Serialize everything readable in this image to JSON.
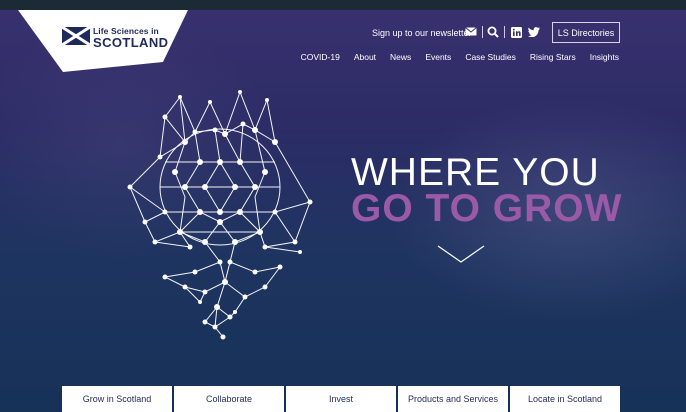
{
  "logo": {
    "top": "Life Sciences in",
    "main": "SCOTLAND"
  },
  "utility": {
    "newsletter": "Sign up to our newsletter",
    "directories": "LS Directories"
  },
  "icons": [
    "envelope-icon",
    "search-icon",
    "linkedin-icon",
    "twitter-icon",
    "chevron-down-icon"
  ],
  "nav": [
    "COVID-19",
    "About",
    "News",
    "Events",
    "Case Studies",
    "Rising Stars",
    "Insights"
  ],
  "hero": {
    "line1": "WHERE YOU",
    "line2": "GO TO GROW"
  },
  "bottom_buttons": [
    "Grow in Scotland",
    "Collaborate",
    "Invest",
    "Products and Services",
    "Locate in Scotland"
  ],
  "colors": {
    "accent_purple": "#9b5aa7",
    "navy": "#1f2a5c",
    "background_top": "#3a3170",
    "background_bottom": "#163257"
  }
}
